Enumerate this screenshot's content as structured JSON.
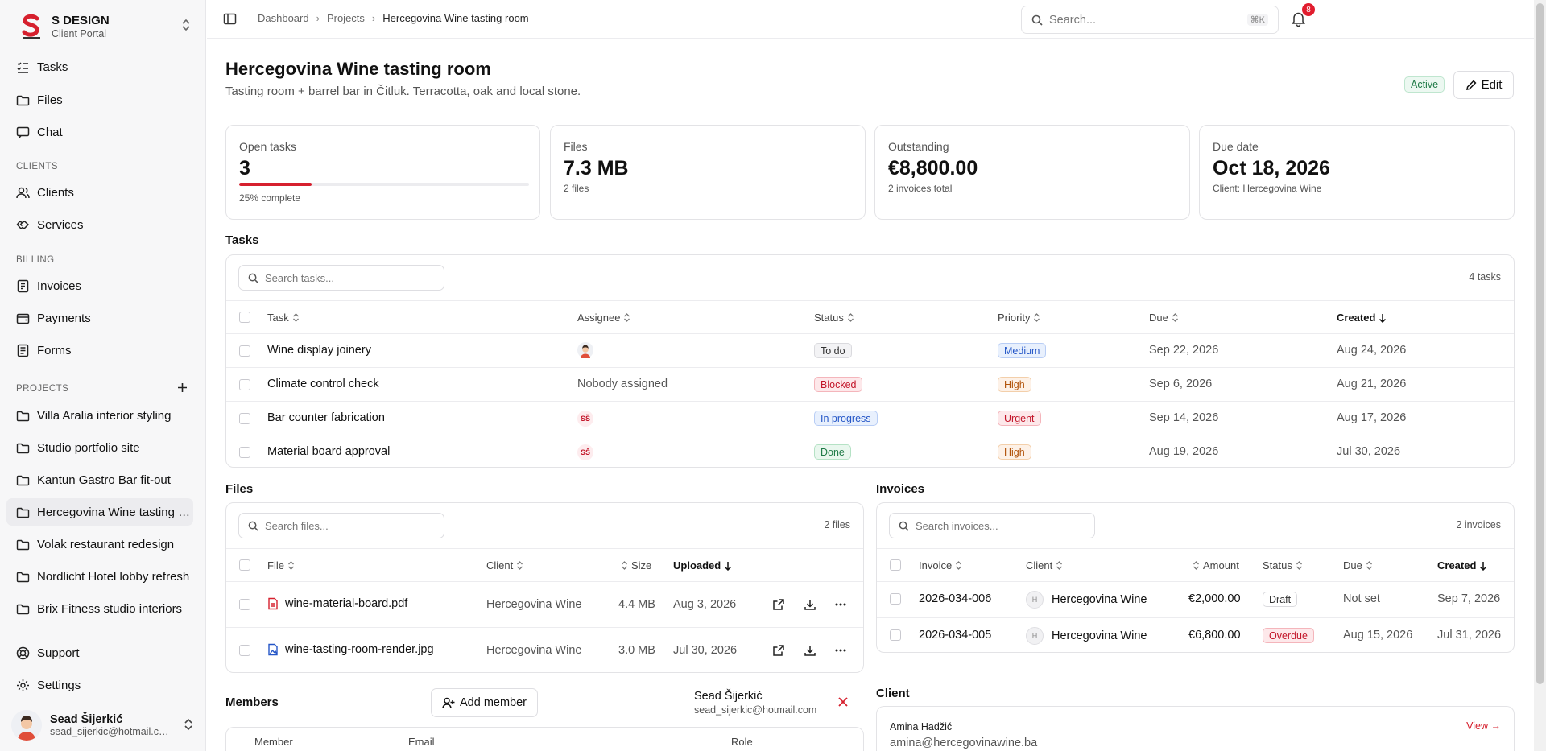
{
  "brand": {
    "name": "S DESIGN",
    "subtitle": "Client Portal"
  },
  "nav": {
    "tasks": "Tasks",
    "files": "Files",
    "chat": "Chat",
    "clients_label": "CLIENTS",
    "clients": "Clients",
    "services": "Services",
    "billing_label": "BILLING",
    "invoices": "Invoices",
    "payments": "Payments",
    "forms": "Forms",
    "projects_label": "PROJECTS",
    "projects": [
      "Villa Aralia interior styling",
      "Studio portfolio site",
      "Kantun Gastro Bar fit-out",
      "Hercegovina Wine tasting room",
      "Volak restaurant redesign",
      "Nordlicht Hotel lobby refresh",
      "Brix Fitness studio interiors"
    ],
    "support": "Support",
    "settings": "Settings"
  },
  "user": {
    "name": "Sead Šijerkić",
    "email": "sead_sijerkic@hotmail.com"
  },
  "breadcrumb": [
    "Dashboard",
    "Projects",
    "Hercegovina Wine tasting room"
  ],
  "search": {
    "placeholder": "Search...",
    "shortcut": "⌘K"
  },
  "notifications": {
    "count": "8"
  },
  "project": {
    "title": "Hercegovina Wine tasting room",
    "subtitle": "Tasting room + barrel bar in Čitluk. Terracotta, oak and local stone.",
    "status": "Active",
    "edit_label": "Edit"
  },
  "stats": {
    "open_tasks": {
      "label": "Open tasks",
      "value": "3",
      "sub": "25% complete",
      "progress": 0.25
    },
    "files": {
      "label": "Files",
      "value": "7.3 MB",
      "sub": "2 files"
    },
    "outstanding": {
      "label": "Outstanding",
      "value": "€8,800.00",
      "sub": "2 invoices total"
    },
    "due": {
      "label": "Due date",
      "value": "Oct 18, 2026",
      "sub": "Client: Hercegovina Wine"
    }
  },
  "tasks": {
    "title": "Tasks",
    "search_placeholder": "Search tasks...",
    "count": "4 tasks",
    "headers": {
      "task": "Task",
      "assignee": "Assignee",
      "status": "Status",
      "priority": "Priority",
      "due": "Due",
      "created": "Created"
    },
    "rows": [
      {
        "task": "Wine display joinery",
        "assignee": "",
        "status": "To do",
        "priority": "Medium",
        "due": "Sep 22, 2026",
        "created": "Aug 24, 2026"
      },
      {
        "task": "Climate control check",
        "assignee": "Nobody assigned",
        "status": "Blocked",
        "priority": "High",
        "due": "Sep 6, 2026",
        "created": "Aug 21, 2026"
      },
      {
        "task": "Bar counter fabrication",
        "assignee": "SŠ",
        "status": "In progress",
        "priority": "Urgent",
        "due": "Sep 14, 2026",
        "created": "Aug 17, 2026"
      },
      {
        "task": "Material board approval",
        "assignee": "SŠ",
        "status": "Done",
        "priority": "High",
        "due": "Aug 19, 2026",
        "created": "Jul 30, 2026"
      }
    ]
  },
  "files": {
    "title": "Files",
    "search_placeholder": "Search files...",
    "count": "2 files",
    "headers": {
      "file": "File",
      "client": "Client",
      "size": "Size",
      "uploaded": "Uploaded"
    },
    "rows": [
      {
        "name": "wine-material-board.pdf",
        "client": "Hercegovina Wine",
        "size": "4.4 MB",
        "uploaded": "Aug 3, 2026"
      },
      {
        "name": "wine-tasting-room-render.jpg",
        "client": "Hercegovina Wine",
        "size": "3.0 MB",
        "uploaded": "Jul 30, 2026"
      }
    ]
  },
  "invoices": {
    "title": "Invoices",
    "search_placeholder": "Search invoices...",
    "count": "2 invoices",
    "headers": {
      "invoice": "Invoice",
      "client": "Client",
      "amount": "Amount",
      "status": "Status",
      "due": "Due",
      "created": "Created"
    },
    "rows": [
      {
        "invoice": "2026-034-006",
        "initial": "H",
        "client": "Hercegovina Wine",
        "amount": "€2,000.00",
        "status": "Draft",
        "due": "Not set",
        "created": "Sep 7, 2026"
      },
      {
        "invoice": "2026-034-005",
        "initial": "H",
        "client": "Hercegovina Wine",
        "amount": "€6,800.00",
        "status": "Overdue",
        "due": "Aug 15, 2026",
        "created": "Jul 31, 2026"
      }
    ]
  },
  "members": {
    "title": "Members",
    "add_label": "Add member",
    "headers": {
      "member": "Member",
      "email": "Email",
      "role": "Role"
    },
    "popover_name": "Sead Šijerkić",
    "popover_email": "sead_sijerkic@hotmail.com"
  },
  "client": {
    "title": "Client",
    "name": "Amina Hadžić",
    "email": "amina@hercegovinawine.ba",
    "view_label": "View →"
  }
}
